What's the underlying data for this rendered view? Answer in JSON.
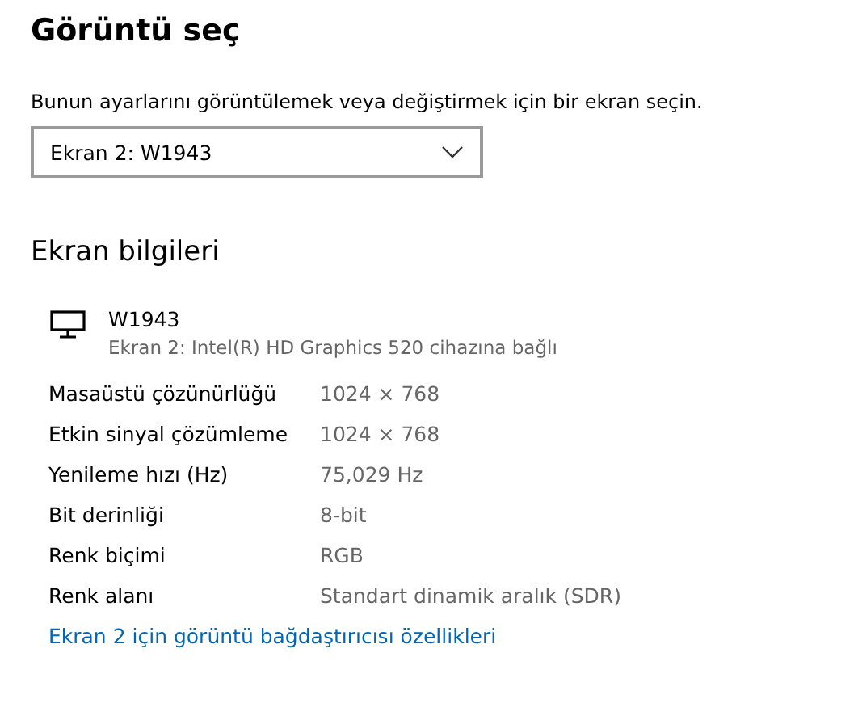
{
  "title": "Görüntü seç",
  "description": "Bunun ayarlarını görüntülemek veya değiştirmek için bir ekran seçin.",
  "display_select": {
    "value": "Ekran 2: W1943"
  },
  "info_heading": "Ekran bilgileri",
  "monitor": {
    "name": "W1943",
    "subtitle": "Ekran 2: Intel(R) HD Graphics 520 cihazına bağlı"
  },
  "properties": [
    {
      "label": "Masaüstü çözünürlüğü",
      "value": "1024 × 768"
    },
    {
      "label": "Etkin sinyal çözümleme",
      "value": "1024 × 768"
    },
    {
      "label": "Yenileme hızı (Hz)",
      "value": "75,029 Hz"
    },
    {
      "label": "Bit derinliği",
      "value": "8-bit"
    },
    {
      "label": "Renk biçimi",
      "value": "RGB"
    },
    {
      "label": "Renk alanı",
      "value": "Standart dinamik aralık (SDR)"
    }
  ],
  "adapter_link": "Ekran 2 için görüntü bağdaştırıcısı özellikleri"
}
